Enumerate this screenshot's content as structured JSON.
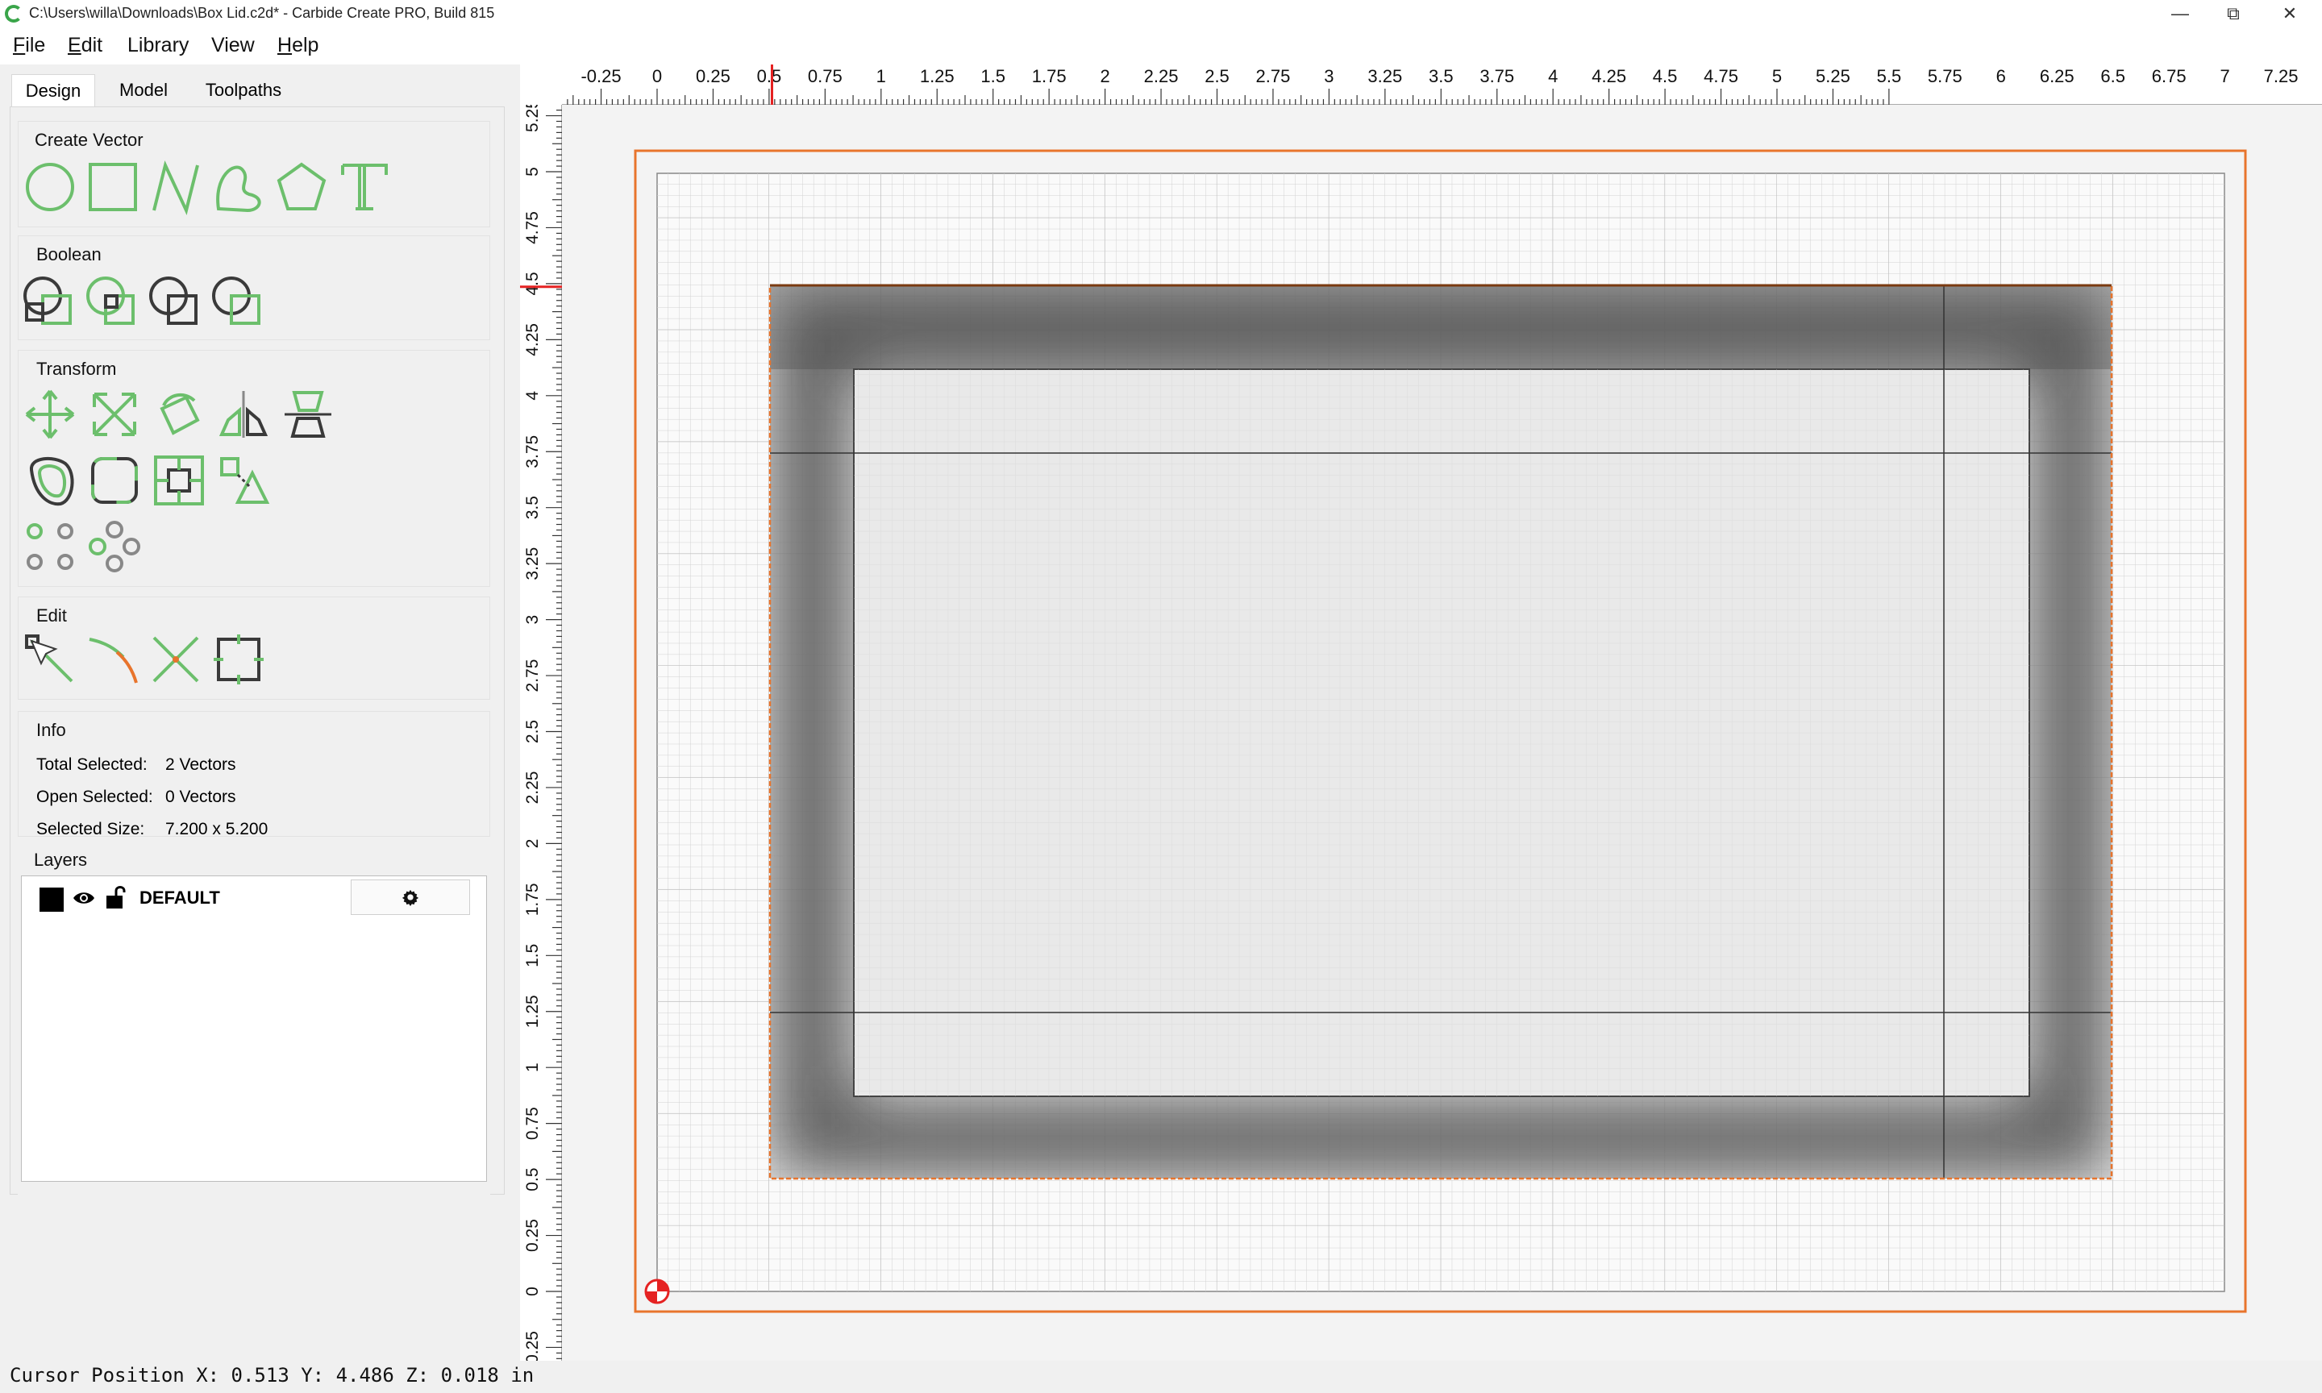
{
  "window": {
    "title": "C:\\Users\\willa\\Downloads\\Box Lid.c2d* - Carbide Create PRO, Build 815",
    "minimize": "—",
    "restore": "⧉",
    "close": "✕"
  },
  "menu": [
    {
      "accel": "F",
      "rest": "ile"
    },
    {
      "accel": "E",
      "rest": "dit"
    },
    {
      "accel": "",
      "rest": "Library"
    },
    {
      "accel": "",
      "rest": "View"
    },
    {
      "accel": "H",
      "rest": "elp"
    }
  ],
  "tabs": [
    "Design",
    "Model",
    "Toolpaths"
  ],
  "active_tab": "Design",
  "groups": {
    "create_vector": "Create Vector",
    "boolean": "Boolean",
    "transform": "Transform",
    "edit": "Edit",
    "info": "Info",
    "layers": "Layers"
  },
  "info": {
    "total_label": "Total Selected:",
    "total_value": "2 Vectors",
    "open_label": "Open Selected:",
    "open_value": "0 Vectors",
    "size_label": "Selected Size:",
    "size_value": "7.200 x 5.200"
  },
  "layers": [
    {
      "name": "DEFAULT",
      "color": "#000000",
      "visible": true,
      "locked": false
    }
  ],
  "icons": {
    "create_vector": [
      "circle-icon",
      "rectangle-icon",
      "polyline-icon",
      "curve-icon",
      "polygon-icon",
      "text-icon"
    ],
    "boolean": [
      "union-icon",
      "subtract-icon",
      "intersect-icon",
      "weld-icon"
    ],
    "transform": [
      "move-icon",
      "scale-icon",
      "rotate-icon",
      "mirror-icon",
      "align-icon",
      "offset-icon",
      "fillet-icon",
      "join-icon",
      "position-icon",
      "circular-array-icon",
      "grid-array-icon",
      "gear-icon"
    ],
    "edit": [
      "node-edit-icon",
      "trim-icon",
      "cut-icon",
      "edit-bounds-icon"
    ]
  },
  "status": {
    "cursor": "Cursor Position X: 0.513 Y: 4.486 Z: 0.018 in"
  },
  "rulers": {
    "h_labels": [
      "-0.25",
      "0",
      "0.25",
      "0.5",
      "0.75",
      "1",
      "1.25",
      "1.5",
      "1.75",
      "2",
      "2.25",
      "2.5",
      "2.75",
      "3",
      "3.25",
      "3.5",
      "3.75",
      "4",
      "4.25",
      "4.5",
      "4.75",
      "5",
      "5.25",
      "5.5",
      "5.75",
      "6",
      "6.25",
      "6.5",
      "6.75",
      "7",
      "7.25"
    ],
    "v_labels": [
      "5.25",
      "5",
      "4.75",
      "4.5",
      "4.25",
      "4",
      "3.75",
      "3.5",
      "3.25",
      "3",
      "2.75",
      "2.5",
      "2.25",
      "2",
      "1.75",
      "1.5",
      "1.25",
      "1",
      "0.75",
      "0.5",
      "0.25",
      "0",
      "0.25"
    ],
    "cursor_x": 0.513,
    "cursor_y": 4.486,
    "units": "in"
  },
  "stock": {
    "width": 7.0,
    "height": 5.0
  },
  "selection": {
    "width": 7.2,
    "height": 5.2
  },
  "colors": {
    "accent_green": "#5cb85c",
    "selection_orange": "#e8742c",
    "ruler_cursor_red": "#e52222"
  }
}
